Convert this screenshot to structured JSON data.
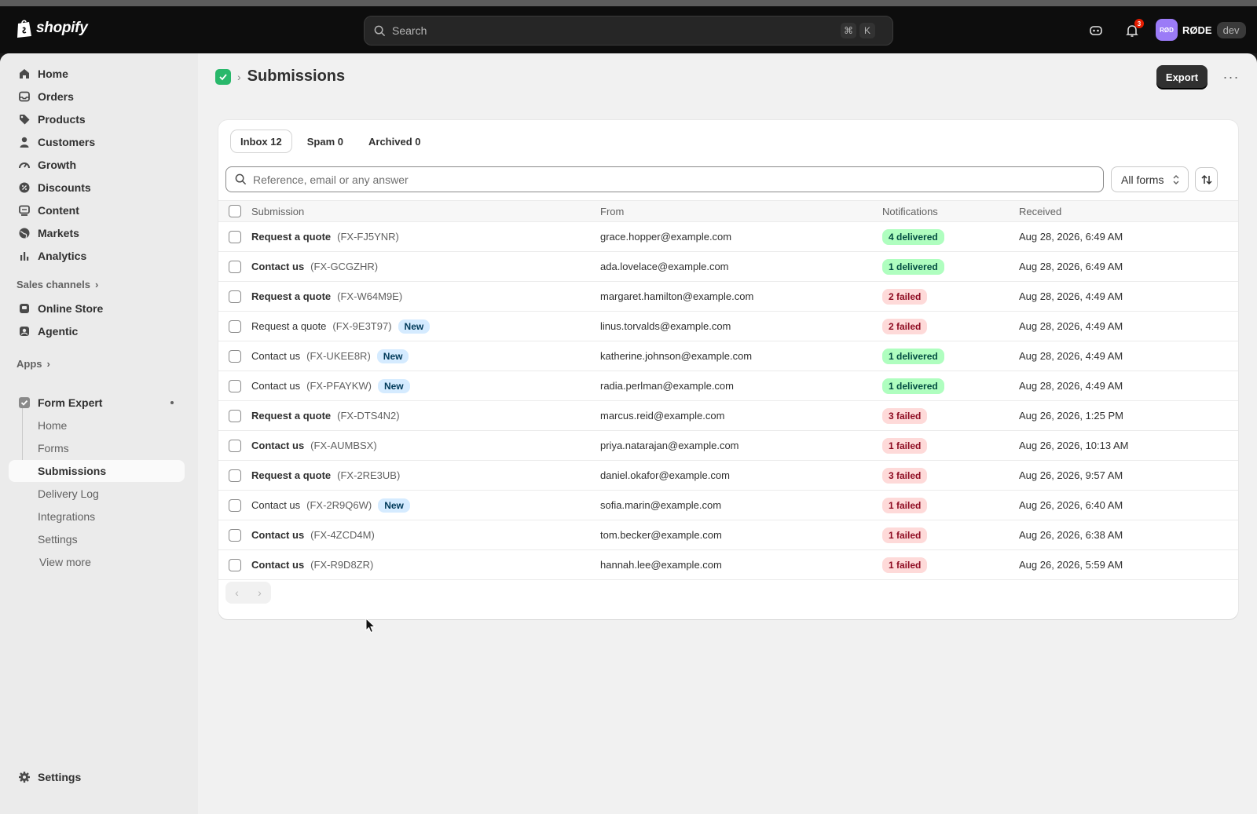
{
  "topbar": {
    "brand": "shopify",
    "search_placeholder": "Search",
    "shortcut_keys": [
      "⌘",
      "K"
    ],
    "notification_count": "3",
    "store_avatar": "RØD",
    "store_name": "RØDE",
    "env_badge": "dev"
  },
  "sidebar": {
    "items": [
      {
        "label": "Home",
        "icon": "home-icon"
      },
      {
        "label": "Orders",
        "icon": "inbox-icon"
      },
      {
        "label": "Products",
        "icon": "tag-icon"
      },
      {
        "label": "Customers",
        "icon": "person-icon"
      },
      {
        "label": "Growth",
        "icon": "gauge-icon"
      },
      {
        "label": "Discounts",
        "icon": "discount-icon"
      },
      {
        "label": "Content",
        "icon": "content-icon"
      },
      {
        "label": "Markets",
        "icon": "globe-icon"
      },
      {
        "label": "Analytics",
        "icon": "bar-chart-icon"
      }
    ],
    "sales_channels_title": "Sales channels",
    "sales_channels": [
      {
        "label": "Online Store",
        "icon": "store-icon"
      },
      {
        "label": "Agentic",
        "icon": "agent-icon"
      }
    ],
    "apps_title": "Apps",
    "app_name": "Form Expert",
    "app_subitems": [
      "Home",
      "Forms",
      "Submissions",
      "Delivery Log",
      "Integrations",
      "Settings"
    ],
    "view_more": "View more",
    "settings": "Settings"
  },
  "page": {
    "title": "Submissions",
    "export_label": "Export",
    "more_label": "···"
  },
  "tabs": [
    {
      "label": "Inbox 12",
      "active": true
    },
    {
      "label": "Spam 0",
      "active": false
    },
    {
      "label": "Archived 0",
      "active": false
    }
  ],
  "filter": {
    "placeholder": "Reference, email or any answer",
    "forms_select": "All forms"
  },
  "table": {
    "headers": {
      "submission": "Submission",
      "from": "From",
      "notifications": "Notifications",
      "received": "Received"
    },
    "rows": [
      {
        "form": "Request a quote",
        "ref": "(FX-FJ5YNR)",
        "unread": true,
        "new": false,
        "from": "grace.hopper@example.com",
        "notif": "4 delivered",
        "status": "ok",
        "received": "Aug 28, 2026, 6:49 AM"
      },
      {
        "form": "Contact us",
        "ref": "(FX-GCGZHR)",
        "unread": true,
        "new": false,
        "from": "ada.lovelace@example.com",
        "notif": "1 delivered",
        "status": "ok",
        "received": "Aug 28, 2026, 6:49 AM"
      },
      {
        "form": "Request a quote",
        "ref": "(FX-W64M9E)",
        "unread": true,
        "new": false,
        "from": "margaret.hamilton@example.com",
        "notif": "2 failed",
        "status": "fail",
        "received": "Aug 28, 2026, 4:49 AM"
      },
      {
        "form": "Request a quote",
        "ref": "(FX-9E3T97)",
        "unread": false,
        "new": true,
        "from": "linus.torvalds@example.com",
        "notif": "2 failed",
        "status": "fail",
        "received": "Aug 28, 2026, 4:49 AM"
      },
      {
        "form": "Contact us",
        "ref": "(FX-UKEE8R)",
        "unread": false,
        "new": true,
        "from": "katherine.johnson@example.com",
        "notif": "1 delivered",
        "status": "ok",
        "received": "Aug 28, 2026, 4:49 AM"
      },
      {
        "form": "Contact us",
        "ref": "(FX-PFAYKW)",
        "unread": false,
        "new": true,
        "from": "radia.perlman@example.com",
        "notif": "1 delivered",
        "status": "ok",
        "received": "Aug 28, 2026, 4:49 AM"
      },
      {
        "form": "Request a quote",
        "ref": "(FX-DTS4N2)",
        "unread": true,
        "new": false,
        "from": "marcus.reid@example.com",
        "notif": "3 failed",
        "status": "fail",
        "received": "Aug 26, 2026, 1:25 PM"
      },
      {
        "form": "Contact us",
        "ref": "(FX-AUMBSX)",
        "unread": true,
        "new": false,
        "from": "priya.natarajan@example.com",
        "notif": "1 failed",
        "status": "fail",
        "received": "Aug 26, 2026, 10:13 AM"
      },
      {
        "form": "Request a quote",
        "ref": "(FX-2RE3UB)",
        "unread": true,
        "new": false,
        "from": "daniel.okafor@example.com",
        "notif": "3 failed",
        "status": "fail",
        "received": "Aug 26, 2026, 9:57 AM"
      },
      {
        "form": "Contact us",
        "ref": "(FX-2R9Q6W)",
        "unread": false,
        "new": true,
        "from": "sofia.marin@example.com",
        "notif": "1 failed",
        "status": "fail",
        "received": "Aug 26, 2026, 6:40 AM"
      },
      {
        "form": "Contact us",
        "ref": "(FX-4ZCD4M)",
        "unread": true,
        "new": false,
        "from": "tom.becker@example.com",
        "notif": "1 failed",
        "status": "fail",
        "received": "Aug 26, 2026, 6:38 AM"
      },
      {
        "form": "Contact us",
        "ref": "(FX-R9D8ZR)",
        "unread": true,
        "new": false,
        "from": "hannah.lee@example.com",
        "notif": "1 failed",
        "status": "fail",
        "received": "Aug 26, 2026, 5:59 AM"
      }
    ],
    "new_badge": "New"
  },
  "pagination": {
    "prev": "‹",
    "next": "›"
  },
  "colors": {
    "accent": "#29b86b",
    "avatar": "#9b7bf7",
    "delivered_bg": "#affebf",
    "failed_bg": "#fedad9",
    "new_bg": "#d5ebff"
  }
}
